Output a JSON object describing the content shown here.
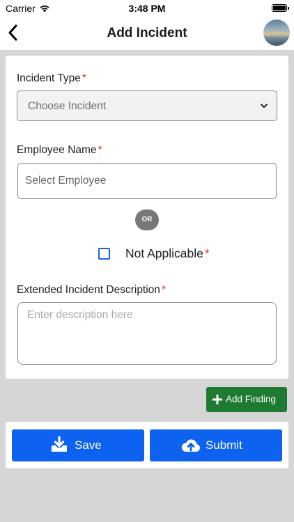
{
  "status_bar": {
    "carrier": "Carrier",
    "time": "3:48 PM"
  },
  "header": {
    "title": "Add Incident"
  },
  "form": {
    "incident_type": {
      "label": "Incident Type",
      "required_mark": "*",
      "value": "Choose Incident"
    },
    "employee_name": {
      "label": "Employee Name",
      "required_mark": "*",
      "placeholder": "Select Employee"
    },
    "or_text": "OR",
    "not_applicable": {
      "label": "Not Applicable",
      "required_mark": "*",
      "checked": false
    },
    "description": {
      "label": "Extended Incident Description",
      "required_mark": "*",
      "placeholder": "Enter description here"
    }
  },
  "actions": {
    "add_finding_label": "Add Finding",
    "save_label": "Save",
    "submit_label": "Submit"
  },
  "colors": {
    "primary": "#0d62f0",
    "success": "#1d7a30",
    "required": "#e03030",
    "checkbox": "#1e63d6",
    "background": "#d6d6d6"
  },
  "icons": {
    "back": "chevron-left-icon",
    "dropdown": "chevron-down-icon",
    "add": "plus-icon",
    "save": "download-tray-icon",
    "submit": "cloud-upload-icon"
  }
}
